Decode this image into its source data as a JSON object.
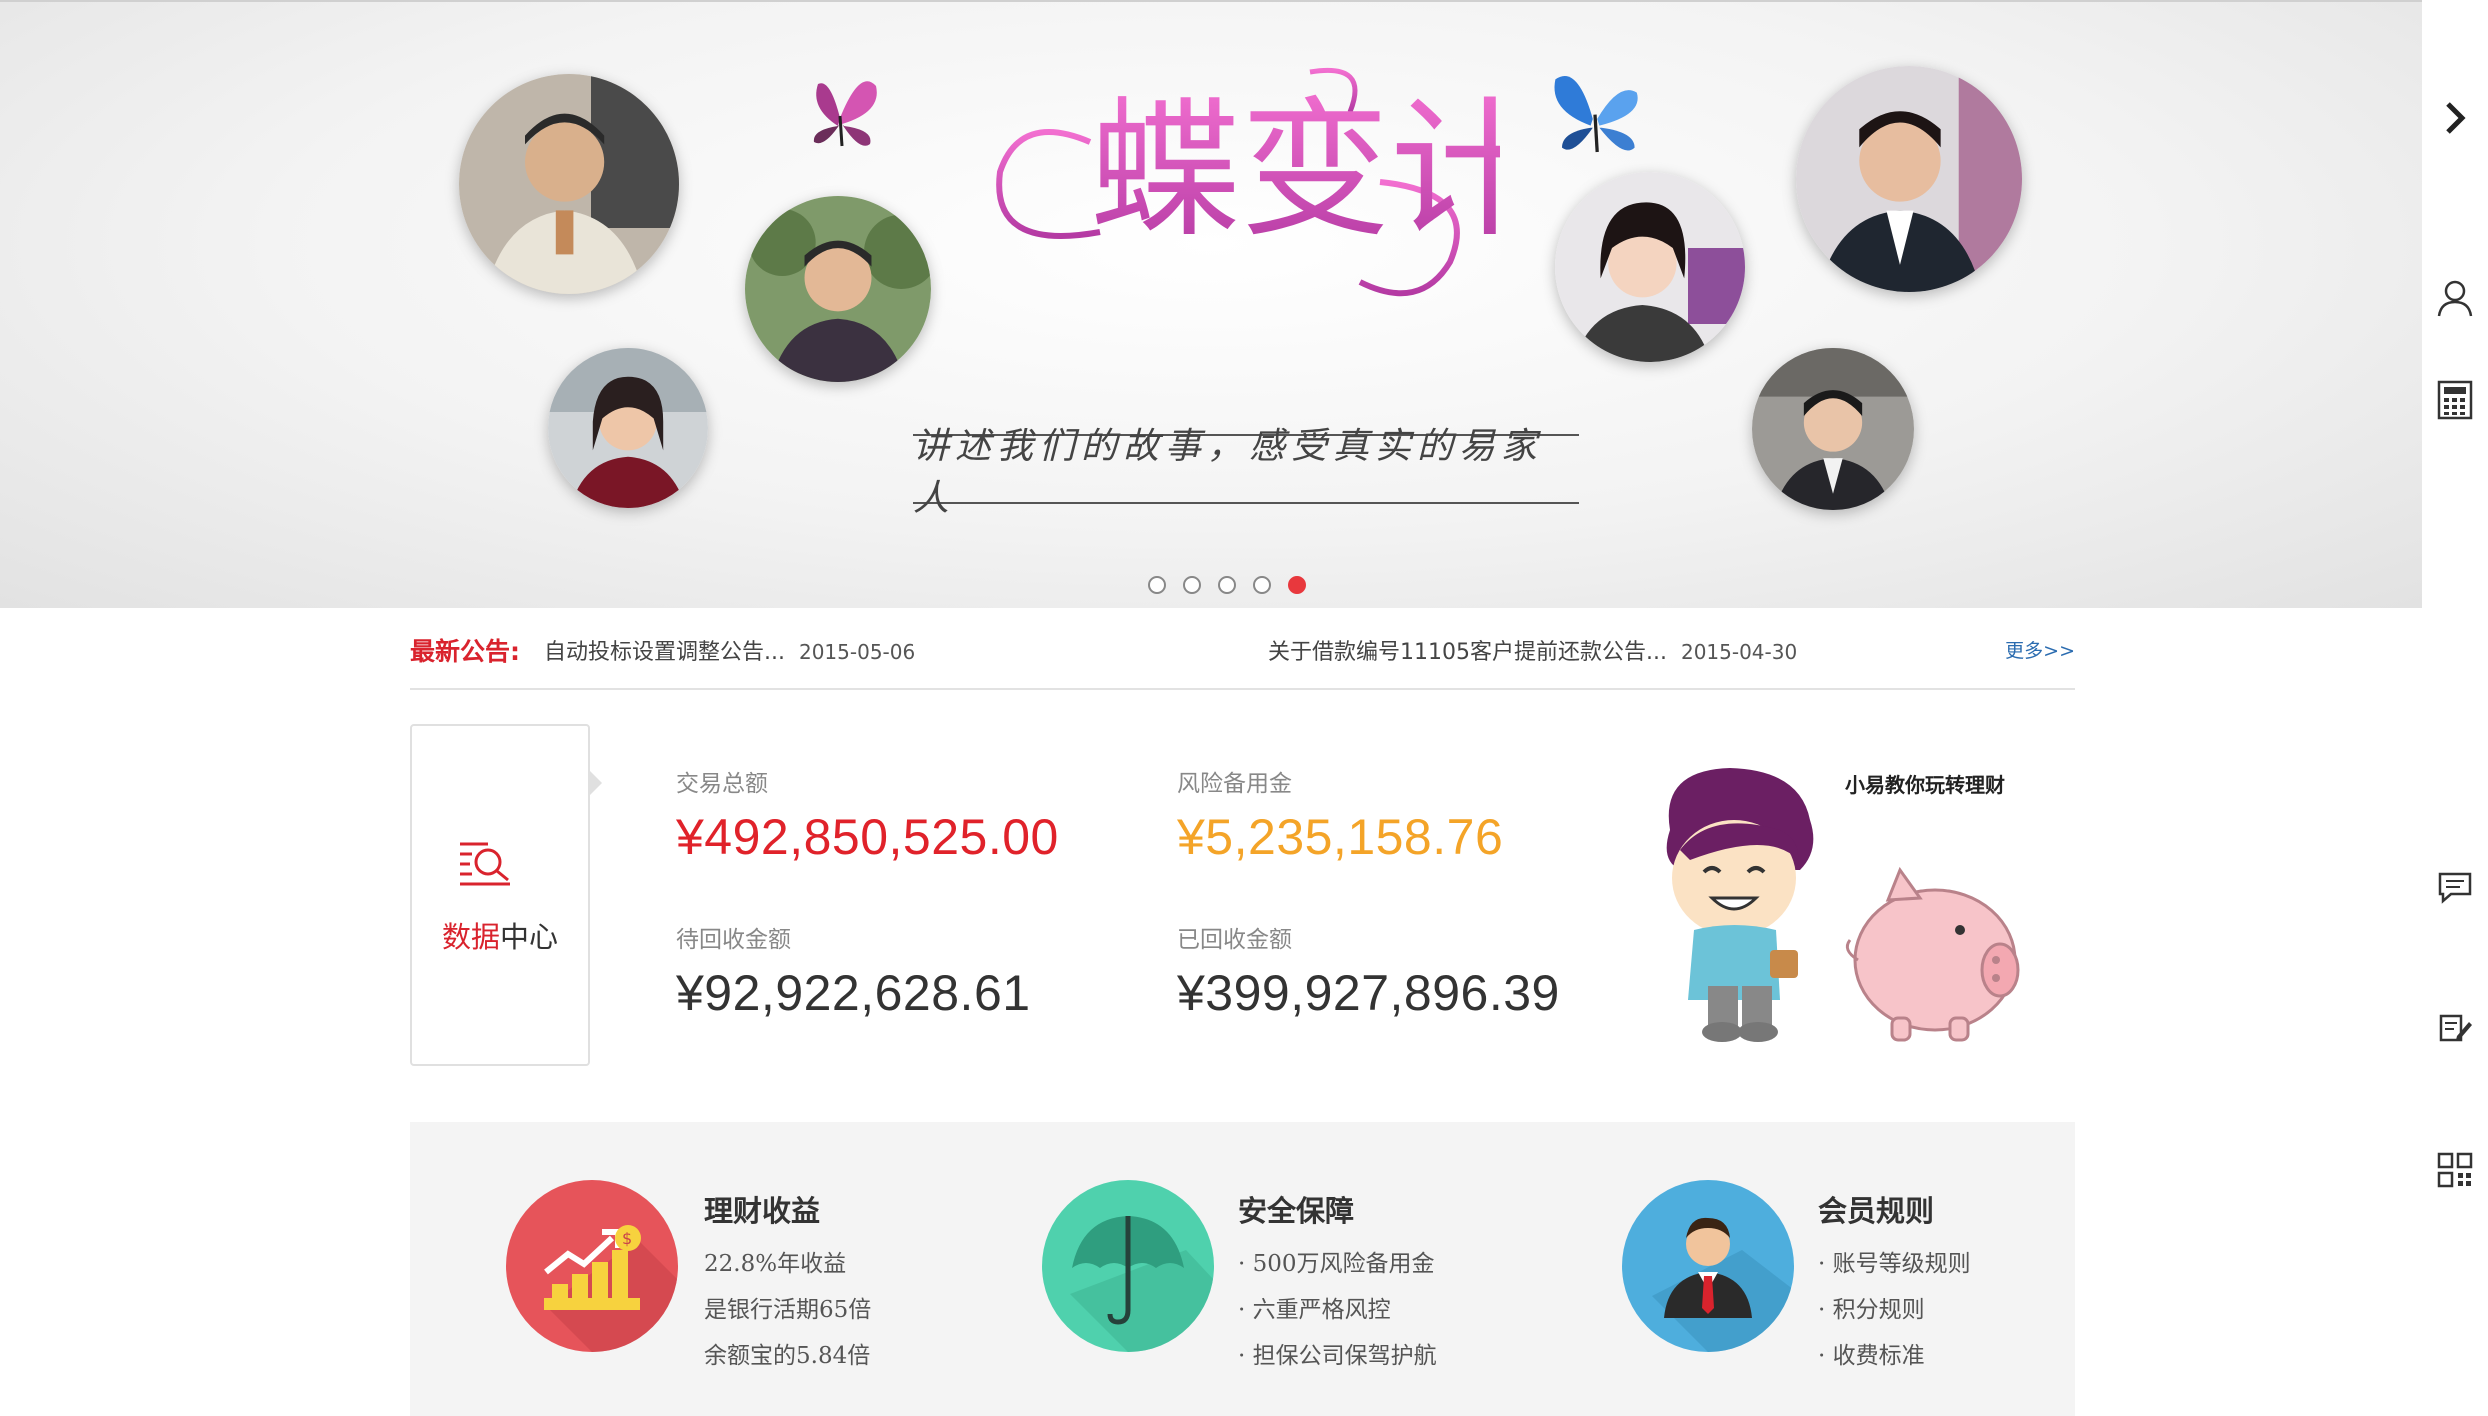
{
  "banner": {
    "slogan": "讲述我们的故事，感受真实的易家人",
    "title_art": "蝶变计",
    "carousel": {
      "total_slides": 5,
      "active_slide": 5
    }
  },
  "sidebar": {
    "icons": [
      "chevron-right-icon",
      "user-icon",
      "calculator-icon",
      "message-icon",
      "edit-icon",
      "qrcode-icon"
    ]
  },
  "notice": {
    "label": "最新公告:",
    "items": [
      {
        "title": "自动投标设置调整公告...",
        "date": "2015-05-06"
      },
      {
        "title": "关于借款编号11105客户提前还款公告...",
        "date": "2015-04-30"
      }
    ],
    "more": "更多>>"
  },
  "data_center": {
    "title_red": "数据",
    "title_dark": "中心",
    "stats": [
      {
        "label": "交易总额",
        "value": "¥492,850,525.00"
      },
      {
        "label": "风险备用金",
        "value": "¥5,235,158.76"
      },
      {
        "label": "待回收金额",
        "value": "¥92,922,628.61"
      },
      {
        "label": "已回收金额",
        "value": "¥399,927,896.39"
      }
    ],
    "mascot_text": "小易教你玩转理财"
  },
  "features": [
    {
      "title": "理财收益",
      "lines": [
        "22.8%年收益",
        "是银行活期65倍",
        "余额宝的5.84倍"
      ],
      "color": "#e6545a"
    },
    {
      "title": "安全保障",
      "lines": [
        "· 500万风险备用金",
        "· 六重严格风控",
        "· 担保公司保驾护航"
      ],
      "color": "#4fd1ad"
    },
    {
      "title": "会员规则",
      "lines": [
        "· 账号等级规则",
        "· 积分规则",
        "· 收费标准"
      ],
      "color": "#4eaedd"
    }
  ],
  "colors": {
    "accent_red": "#d9232d",
    "orange": "#f4a428",
    "link_blue": "#2b6cb0"
  }
}
